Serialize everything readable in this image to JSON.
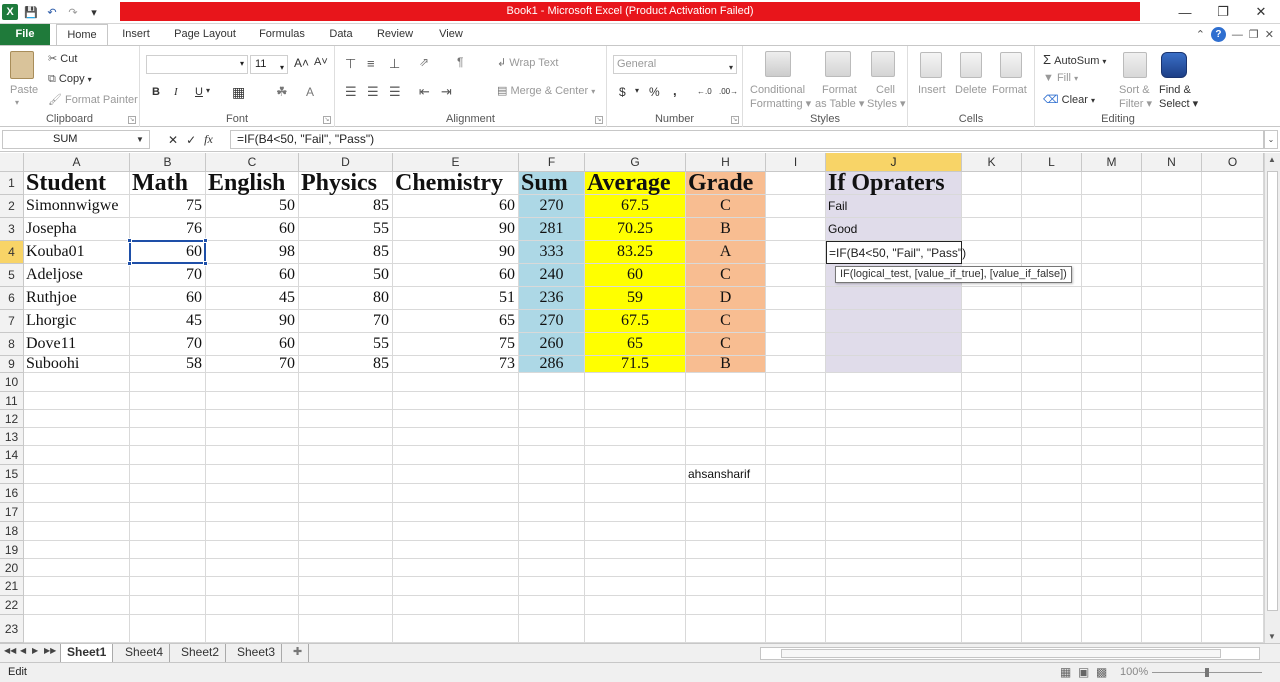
{
  "window": {
    "title": "Book1  -  Microsoft Excel (Product Activation Failed)"
  },
  "ribbon_tabs": [
    "File",
    "Home",
    "Insert",
    "Page Layout",
    "Formulas",
    "Data",
    "Review",
    "View"
  ],
  "ribbon": {
    "clipboard": {
      "label": "Clipboard",
      "paste": "Paste",
      "cut": "Cut",
      "copy": "Copy",
      "format_painter": "Format Painter"
    },
    "font": {
      "label": "Font",
      "size": "11",
      "bold": "B",
      "italic": "I",
      "underline": "U",
      "grow": "A˄",
      "shrink": "A˅"
    },
    "alignment": {
      "label": "Alignment",
      "wrap_text": "Wrap Text",
      "merge_center": "Merge & Center"
    },
    "number": {
      "label": "Number",
      "format": "General",
      "currency": "$",
      "percent": "%",
      "comma": ",",
      "inc": "←.0",
      "dec": ".00→"
    },
    "styles": {
      "label": "Styles",
      "conditional": "Conditional",
      "conditional2": "Formatting",
      "format_table": "Format",
      "format_table2": "as Table",
      "cell_styles": "Cell",
      "cell_styles2": "Styles"
    },
    "cells": {
      "label": "Cells",
      "insert": "Insert",
      "delete": "Delete",
      "format": "Format"
    },
    "editing": {
      "label": "Editing",
      "autosum": "AutoSum",
      "fill": "Fill",
      "clear": "Clear",
      "sort": "Sort &",
      "sort2": "Filter",
      "find": "Find &",
      "find2": "Select"
    }
  },
  "formula_bar": {
    "name_box": "SUM",
    "fx": "fx",
    "formula": "=IF(B4<50, \"Fail\", \"Pass\")"
  },
  "columns": [
    "A",
    "B",
    "C",
    "D",
    "E",
    "F",
    "G",
    "H",
    "I",
    "J",
    "K",
    "L",
    "M",
    "N",
    "O"
  ],
  "table": {
    "headers": [
      "Student",
      "Math",
      "English",
      "Physics",
      "Chemistry",
      "Sum",
      "Average",
      "Grade"
    ],
    "rows": [
      [
        "Simonnwigwe",
        "75",
        "50",
        "85",
        "60",
        "270",
        "67.5",
        "C"
      ],
      [
        "Josepha",
        "76",
        "60",
        "55",
        "90",
        "281",
        "70.25",
        "B"
      ],
      [
        "Kouba01",
        "60",
        "98",
        "85",
        "90",
        "333",
        "83.25",
        "A"
      ],
      [
        "Adeljose",
        "70",
        "60",
        "50",
        "60",
        "240",
        "60",
        "C"
      ],
      [
        "Ruthjoe",
        "60",
        "45",
        "80",
        "51",
        "236",
        "59",
        "D"
      ],
      [
        "Lhorgic",
        "45",
        "90",
        "70",
        "65",
        "270",
        "67.5",
        "C"
      ],
      [
        "Dove11",
        "70",
        "60",
        "55",
        "75",
        "260",
        "65",
        "C"
      ],
      [
        "Suboohi",
        "58",
        "70",
        "85",
        "73",
        "286",
        "71.5",
        "B"
      ]
    ]
  },
  "side": {
    "title": "If Opraters",
    "j2": "Fail",
    "j3": "Good",
    "editing_cell": "=IF(B4<50, \"Fail\", \"Pass\")",
    "h15": "ahsansharif"
  },
  "tooltip": "IF(logical_test, [value_if_true], [value_if_false])",
  "sheets": [
    "Sheet1",
    "Sheet4",
    "Sheet2",
    "Sheet3"
  ],
  "status": {
    "mode": "Edit",
    "zoom": "100%"
  },
  "colors": {
    "sum": "#add8e6",
    "average": "#ffff00",
    "grade": "#f8bd91",
    "side": "#e0dcea",
    "file_tab": "#1f7a3a",
    "title_bar": "#e8151b"
  }
}
